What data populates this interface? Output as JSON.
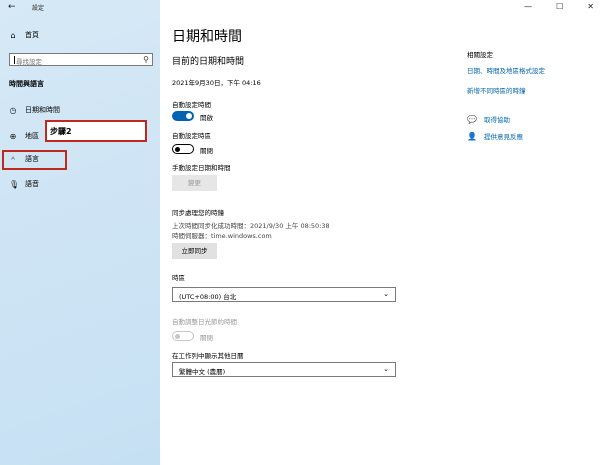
{
  "window": {
    "app_title": "設定",
    "back_icon": "back-arrow-icon",
    "controls": [
      "minimize-icon",
      "maximize-icon",
      "close-icon"
    ]
  },
  "sidebar": {
    "home_label": "首頁",
    "search_placeholder": "尋找設定",
    "section_title": "時間與語言",
    "items": [
      {
        "label": "日期和時間",
        "icon": "calendar-clock-icon"
      },
      {
        "label": "地區",
        "icon": "globe-icon"
      },
      {
        "label": "語言",
        "icon": "language-icon"
      },
      {
        "label": "語音",
        "icon": "microphone-icon"
      }
    ]
  },
  "annotation": {
    "step_label": "步驟2",
    "highlight_color": "#c0271d"
  },
  "main": {
    "title": "日期和時間",
    "subtitle": "目前的日期和時間",
    "current_datetime": "2021年9月30日，下午 04:16",
    "auto_time": {
      "label": "自動設定時間",
      "state": "開啟",
      "on": true
    },
    "auto_timezone": {
      "label": "自動設定時區",
      "state": "關閉",
      "on": false
    },
    "manual": {
      "label": "手動設定日期和時間",
      "button": "變更"
    },
    "sync": {
      "title": "同步處理您的時鐘",
      "last_sync": "上次時間同步化成功時間：2021/9/30 上午 08:50:38",
      "server": "時間伺服器：time.windows.com",
      "button": "立即同步"
    },
    "timezone": {
      "label": "時區",
      "value": "(UTC+08:00) 台北"
    },
    "dst": {
      "label": "自動調整日光節約時間",
      "state": "關閉",
      "enabled": false
    },
    "calendar": {
      "label": "在工作列中顯示其他日曆",
      "value": "繁體中文 (農曆)"
    }
  },
  "related": {
    "title": "相關設定",
    "link1": "日期、時間及地區格式設定",
    "link2": "新增不同時區的時鐘",
    "help": "取得協助",
    "feedback": "提供意見反應"
  },
  "colors": {
    "accent": "#0063b1",
    "link": "#0066b4",
    "sidebar_bg": "#d0e6f5"
  }
}
